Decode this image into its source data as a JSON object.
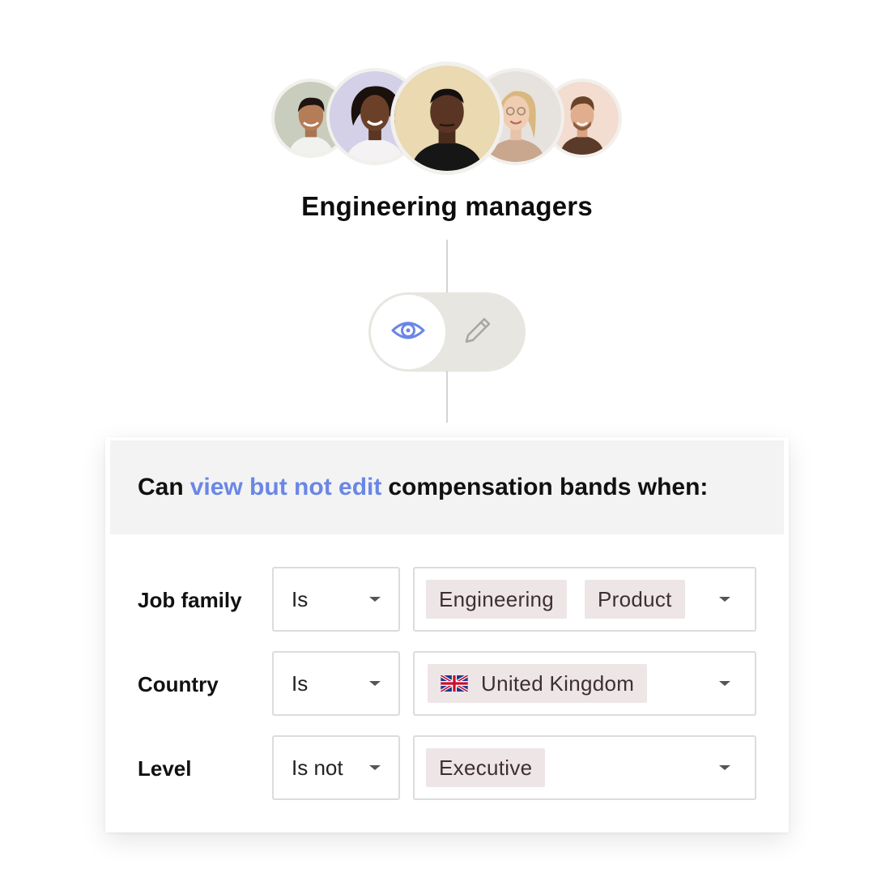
{
  "group": {
    "title": "Engineering managers",
    "avatars": [
      {
        "name": "avatar-1",
        "bg": "#c9cdbd"
      },
      {
        "name": "avatar-2",
        "bg": "#d3d0e8"
      },
      {
        "name": "avatar-3",
        "bg": "#ead9b1"
      },
      {
        "name": "avatar-4",
        "bg": "#e6e3de"
      },
      {
        "name": "avatar-5",
        "bg": "#f3dcd0"
      }
    ]
  },
  "toggle": {
    "selected": "view",
    "options": [
      {
        "id": "view",
        "icon": "eye-icon"
      },
      {
        "id": "edit",
        "icon": "pencil-icon"
      }
    ],
    "accent": "#6a86e6"
  },
  "card": {
    "header": {
      "prefix": "Can",
      "highlight": "view but not edit",
      "suffix": "compensation bands when:"
    },
    "rules": [
      {
        "label": "Job family",
        "operator": "Is",
        "values": [
          "Engineering",
          "Product"
        ]
      },
      {
        "label": "Country",
        "operator": "Is",
        "values": [
          "United Kingdom"
        ],
        "flag": "uk-flag-icon"
      },
      {
        "label": "Level",
        "operator": "Is not",
        "values": [
          "Executive"
        ]
      }
    ]
  }
}
